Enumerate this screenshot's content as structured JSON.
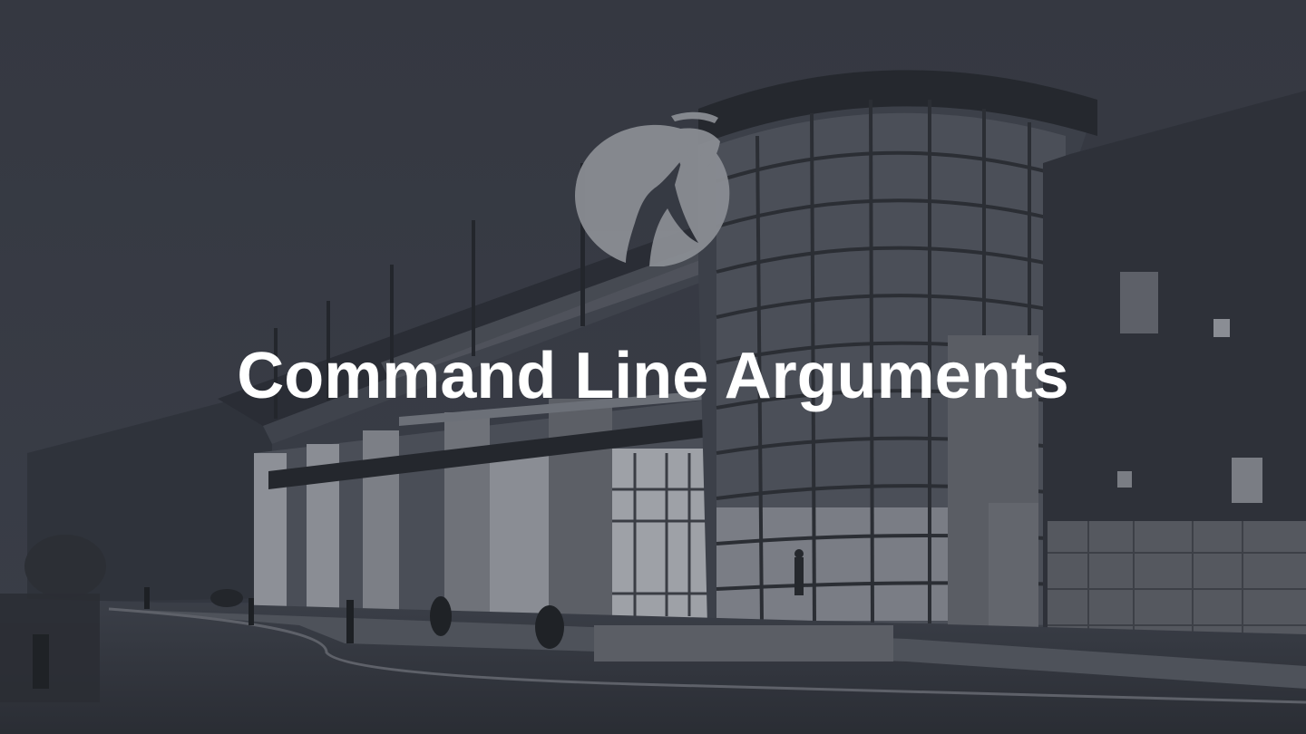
{
  "slide": {
    "title": "Command Line Arguments",
    "logo_icon": "person-reaching-logo-icon",
    "background": "building-exterior-photo-dimmed"
  },
  "colors": {
    "overlay": "#2f333c",
    "title_text": "#ffffff",
    "logo": "#8a8d93"
  }
}
